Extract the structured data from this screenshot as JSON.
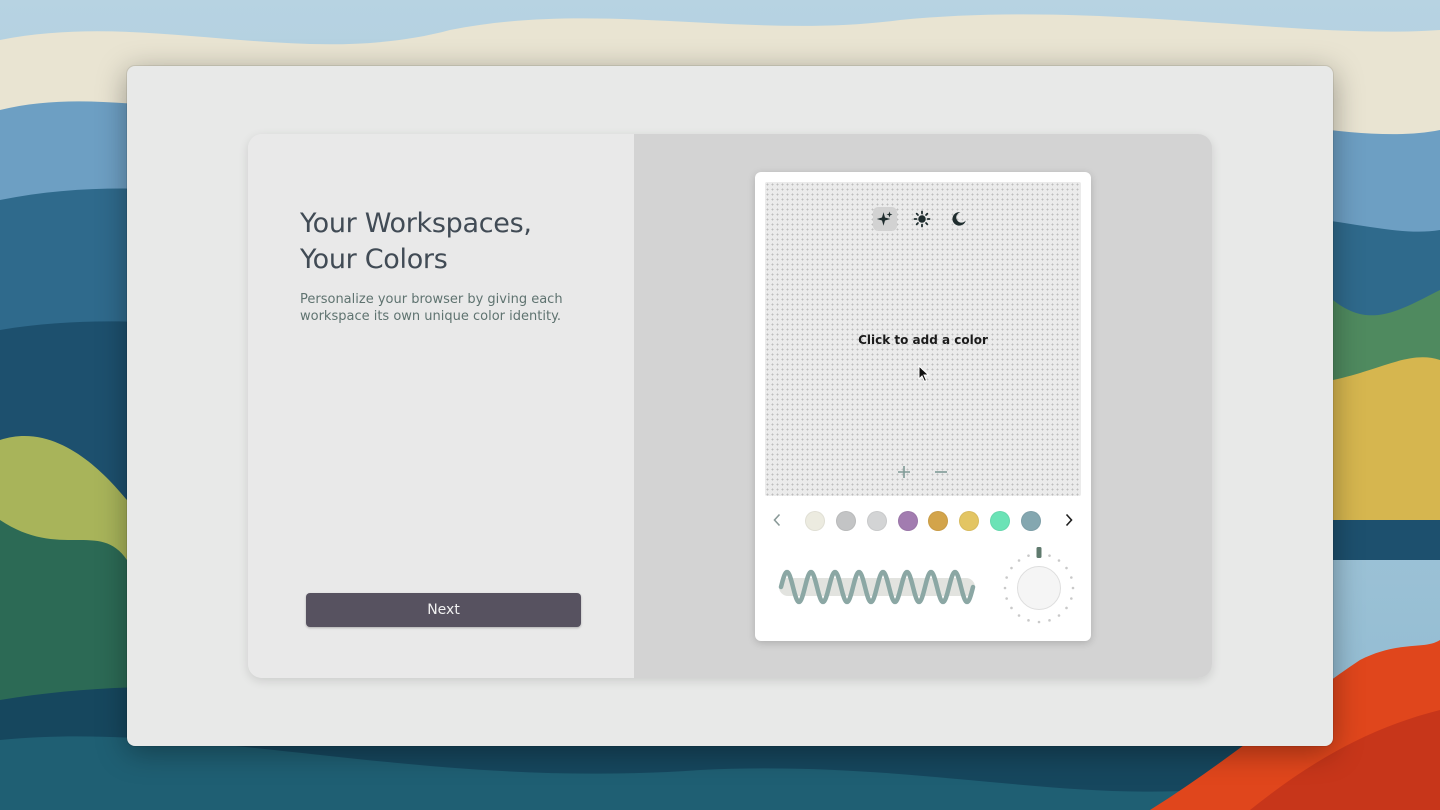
{
  "onboarding": {
    "title_line1": "Your Workspaces,",
    "title_line2": "Your Colors",
    "description": "Personalize your browser by giving each workspace its own unique color identity.",
    "next_label": "Next"
  },
  "picker": {
    "modes": [
      {
        "icon": "sparkle-icon",
        "active": true
      },
      {
        "icon": "sun-icon",
        "active": false
      },
      {
        "icon": "moon-icon",
        "active": false
      }
    ],
    "hint": "Click to add a color",
    "zoom_in_icon": "plus-icon",
    "zoom_out_icon": "minus-icon",
    "swatch_colors": [
      "#ecebe0",
      "#c3c4c5",
      "#d3d4d5",
      "#a27cb0",
      "#d3a44a",
      "#e3c563",
      "#6be3b6",
      "#84a7b0"
    ],
    "nav_left_icon": "chevron-left-icon",
    "nav_right_icon": "chevron-right-icon",
    "wave_color": "#8ba7a4",
    "dial_marker_color": "#5f7a6e"
  }
}
